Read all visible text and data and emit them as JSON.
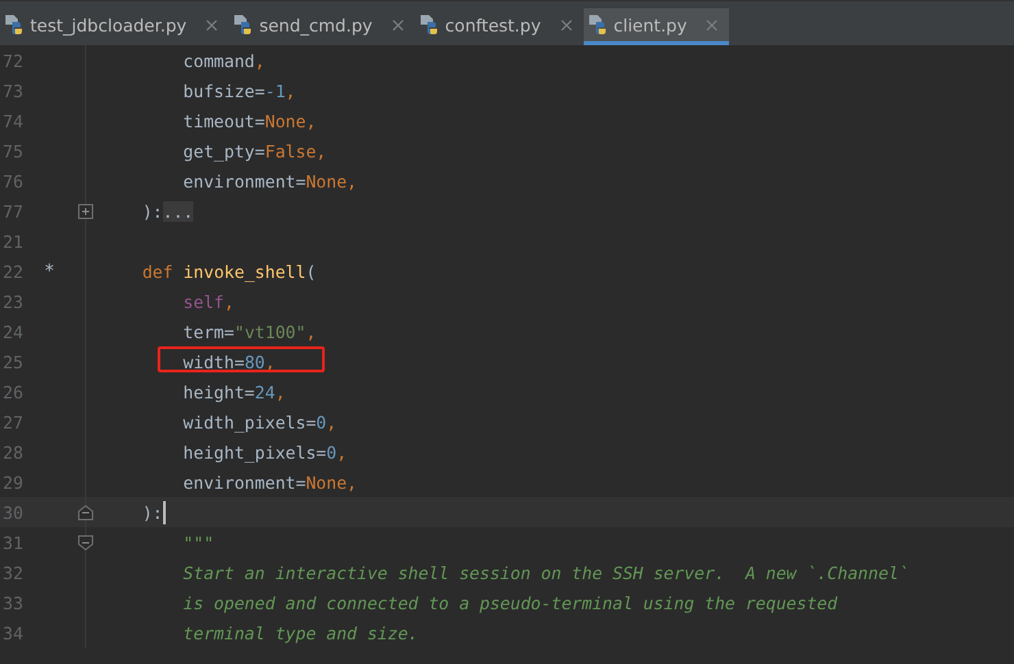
{
  "tabs": [
    {
      "label": "test_jdbcloader.py",
      "selected": false
    },
    {
      "label": "send_cmd.py",
      "selected": false
    },
    {
      "label": "conftest.py",
      "selected": false
    },
    {
      "label": "client.py",
      "selected": true
    }
  ],
  "lines": [
    {
      "number": "72",
      "tokens": [
        {
          "kind": "plain",
          "text": "        command"
        },
        {
          "kind": "punct",
          "text": ","
        }
      ]
    },
    {
      "number": "73",
      "tokens": [
        {
          "kind": "plain",
          "text": "        bufsize="
        },
        {
          "kind": "number",
          "text": "-1"
        },
        {
          "kind": "punct",
          "text": ","
        }
      ]
    },
    {
      "number": "74",
      "tokens": [
        {
          "kind": "plain",
          "text": "        timeout="
        },
        {
          "kind": "keyword",
          "text": "None"
        },
        {
          "kind": "punct",
          "text": ","
        }
      ]
    },
    {
      "number": "75",
      "tokens": [
        {
          "kind": "plain",
          "text": "        get_pty="
        },
        {
          "kind": "keyword",
          "text": "False"
        },
        {
          "kind": "punct",
          "text": ","
        }
      ]
    },
    {
      "number": "76",
      "tokens": [
        {
          "kind": "plain",
          "text": "        environment="
        },
        {
          "kind": "keyword",
          "text": "None"
        },
        {
          "kind": "punct",
          "text": ","
        }
      ]
    },
    {
      "number": "77",
      "folded": true,
      "tokens": [
        {
          "kind": "plain",
          "text": "    ):"
        },
        {
          "kind": "folded",
          "text": "..."
        }
      ]
    },
    {
      "number": "21"
    },
    {
      "number": "22",
      "marker": "*",
      "tokens": [
        {
          "kind": "keyword",
          "text": "    def "
        },
        {
          "kind": "function",
          "text": "invoke_shell"
        },
        {
          "kind": "plain",
          "text": "("
        }
      ]
    },
    {
      "number": "23",
      "tokens": [
        {
          "kind": "self",
          "text": "        self"
        },
        {
          "kind": "punct",
          "text": ","
        }
      ]
    },
    {
      "number": "24",
      "tokens": [
        {
          "kind": "plain",
          "text": "        term="
        },
        {
          "kind": "string",
          "text": "\"vt100\""
        },
        {
          "kind": "punct",
          "text": ","
        }
      ]
    },
    {
      "number": "25",
      "annotated": true,
      "tokens": [
        {
          "kind": "plain",
          "text": "        width="
        },
        {
          "kind": "number",
          "text": "80"
        },
        {
          "kind": "punct",
          "text": ","
        }
      ]
    },
    {
      "number": "26",
      "tokens": [
        {
          "kind": "plain",
          "text": "        height="
        },
        {
          "kind": "number",
          "text": "24"
        },
        {
          "kind": "punct",
          "text": ","
        }
      ]
    },
    {
      "number": "27",
      "tokens": [
        {
          "kind": "plain",
          "text": "        width_pixels="
        },
        {
          "kind": "number",
          "text": "0"
        },
        {
          "kind": "punct",
          "text": ","
        }
      ]
    },
    {
      "number": "28",
      "tokens": [
        {
          "kind": "plain",
          "text": "        height_pixels="
        },
        {
          "kind": "number",
          "text": "0"
        },
        {
          "kind": "punct",
          "text": ","
        }
      ]
    },
    {
      "number": "29",
      "tokens": [
        {
          "kind": "plain",
          "text": "        environment="
        },
        {
          "kind": "keyword",
          "text": "None"
        },
        {
          "kind": "punct",
          "text": ","
        }
      ]
    },
    {
      "number": "30",
      "current": true,
      "fold_end": true,
      "tokens": [
        {
          "kind": "plain",
          "text": "    ):"
        }
      ]
    },
    {
      "number": "31",
      "fold_start": true,
      "tokens": [
        {
          "kind": "doc",
          "text": "        \"\"\""
        }
      ]
    },
    {
      "number": "32",
      "tokens": [
        {
          "kind": "doc",
          "text": "        Start an interactive shell session on the SSH server.  A new `.Channel`"
        }
      ]
    },
    {
      "number": "33",
      "tokens": [
        {
          "kind": "doc",
          "text": "        is opened and connected to a pseudo-terminal using the requested"
        }
      ]
    },
    {
      "number": "34",
      "tokens": [
        {
          "kind": "doc",
          "text": "        terminal type and size."
        }
      ]
    }
  ]
}
